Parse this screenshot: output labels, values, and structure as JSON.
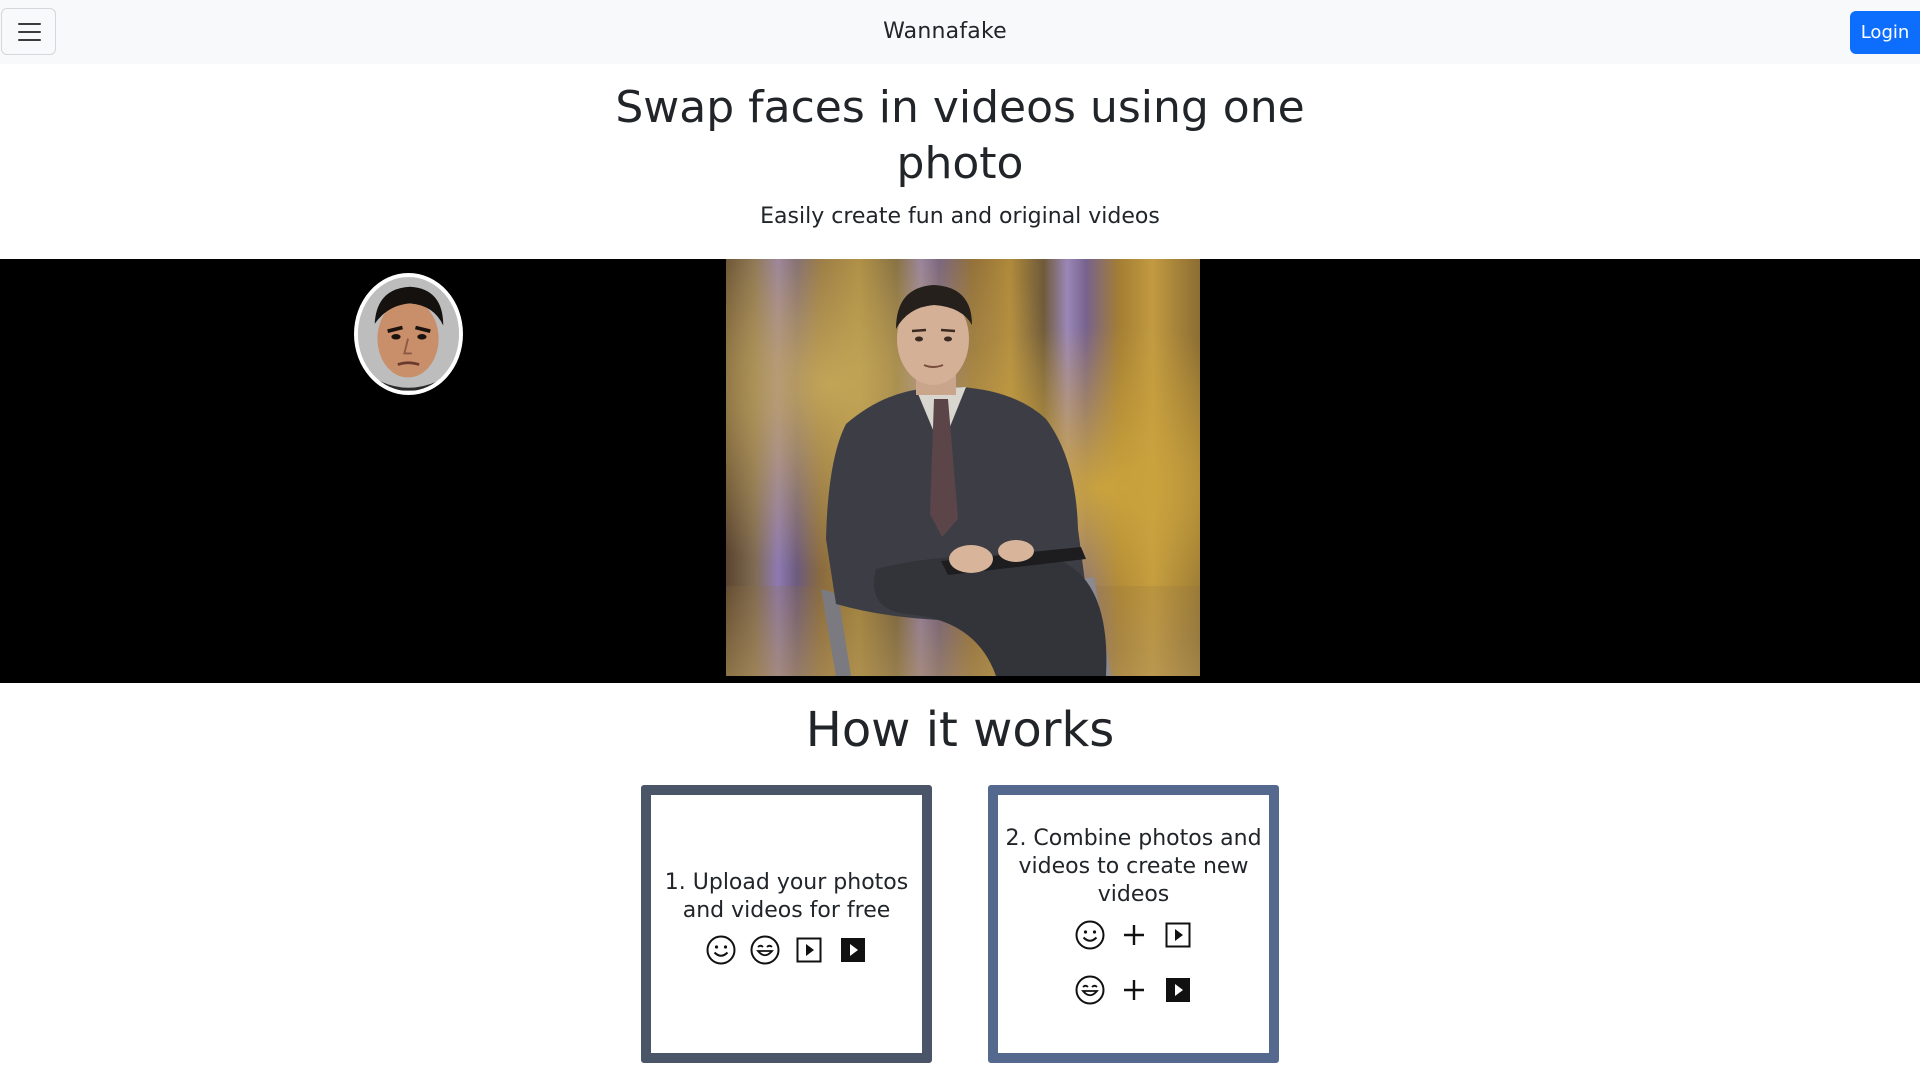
{
  "navbar": {
    "brand": "Wannafake",
    "menu_icon": "hamburger-menu-icon",
    "login_label": "Login",
    "login_color": "#0d6efd"
  },
  "hero": {
    "title_line1": "Swap faces in videos using one",
    "title_line2": "photo",
    "subtitle": "Easily create fun and original videos"
  },
  "video": {
    "overlay_icon": "source-face-avatar"
  },
  "how_it_works": {
    "title": "How it works",
    "steps": [
      {
        "text": "1. Upload your photos and videos for free",
        "border_color": "#4a5567",
        "icons": [
          "smiley-icon",
          "smiley-icon",
          "video-play-outline-icon",
          "video-play-filled-icon"
        ]
      },
      {
        "text": "2. Combine photos and videos to create new videos",
        "border_color": "#55698f",
        "icon_rows": [
          [
            "smiley-icon",
            "plus-icon",
            "video-play-outline-icon"
          ],
          [
            "smiley-icon",
            "plus-icon",
            "video-play-filled-icon"
          ]
        ]
      }
    ]
  }
}
